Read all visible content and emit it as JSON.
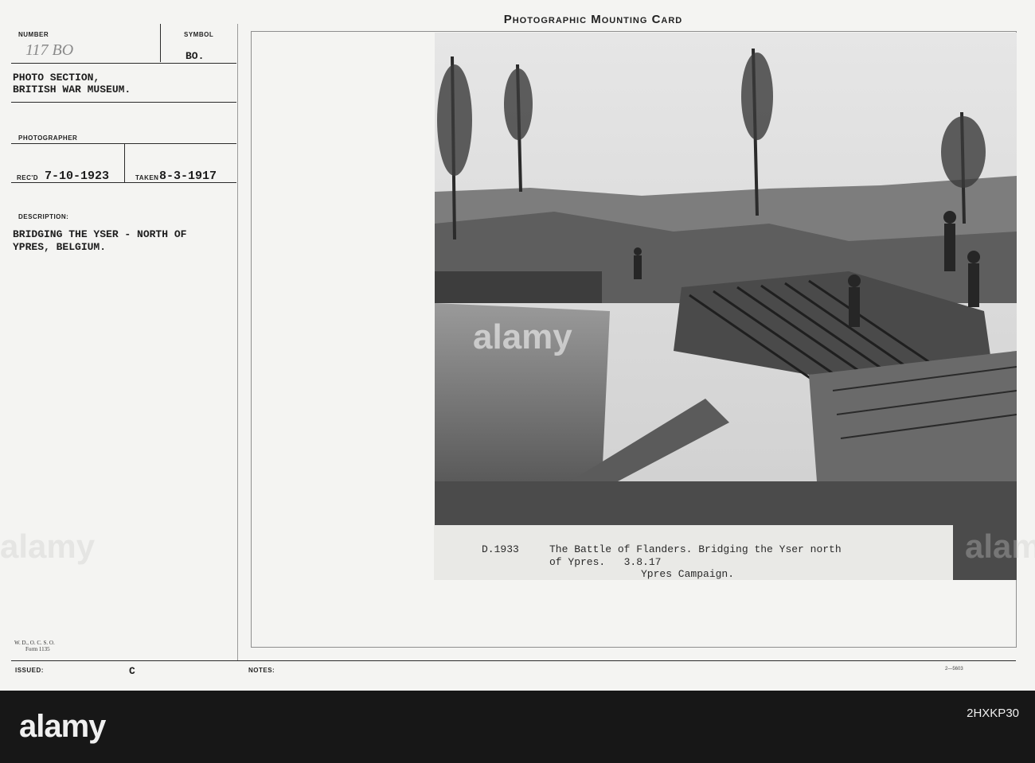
{
  "card": {
    "header_title": "Photographic Mounting Card",
    "number_label": "NUMBER",
    "number_value": "117 BO",
    "symbol_label": "SYMBOL",
    "symbol_value": "BO.",
    "section_line1": "PHOTO SECTION,",
    "section_line2": "BRITISH WAR MUSEUM.",
    "photographer_label": "PHOTOGRAPHER",
    "recd_label": "REC'D",
    "recd_value": "7-10-1923",
    "taken_label": "TAKEN",
    "taken_value": "8-3-1917",
    "description_label": "DESCRIPTION:",
    "description_line1": "BRIDGING THE YSER - NORTH OF",
    "description_line2": "YPRES, BELGIUM.",
    "form_line1": "W. D., O. C. S. O.",
    "form_line2": "Form 1135",
    "issued_label": "ISSUED:",
    "issued_value": "C",
    "notes_label": "NOTES:",
    "print_code": "2—5603"
  },
  "caption": {
    "ref": "D.1933",
    "line1": "The Battle of Flanders. Bridging the Yser north",
    "line2": "of Ypres.   3.8.17",
    "line3": "Ypres Campaign."
  },
  "watermark": {
    "text": "alamy",
    "stock_id": "2HXKP30"
  }
}
